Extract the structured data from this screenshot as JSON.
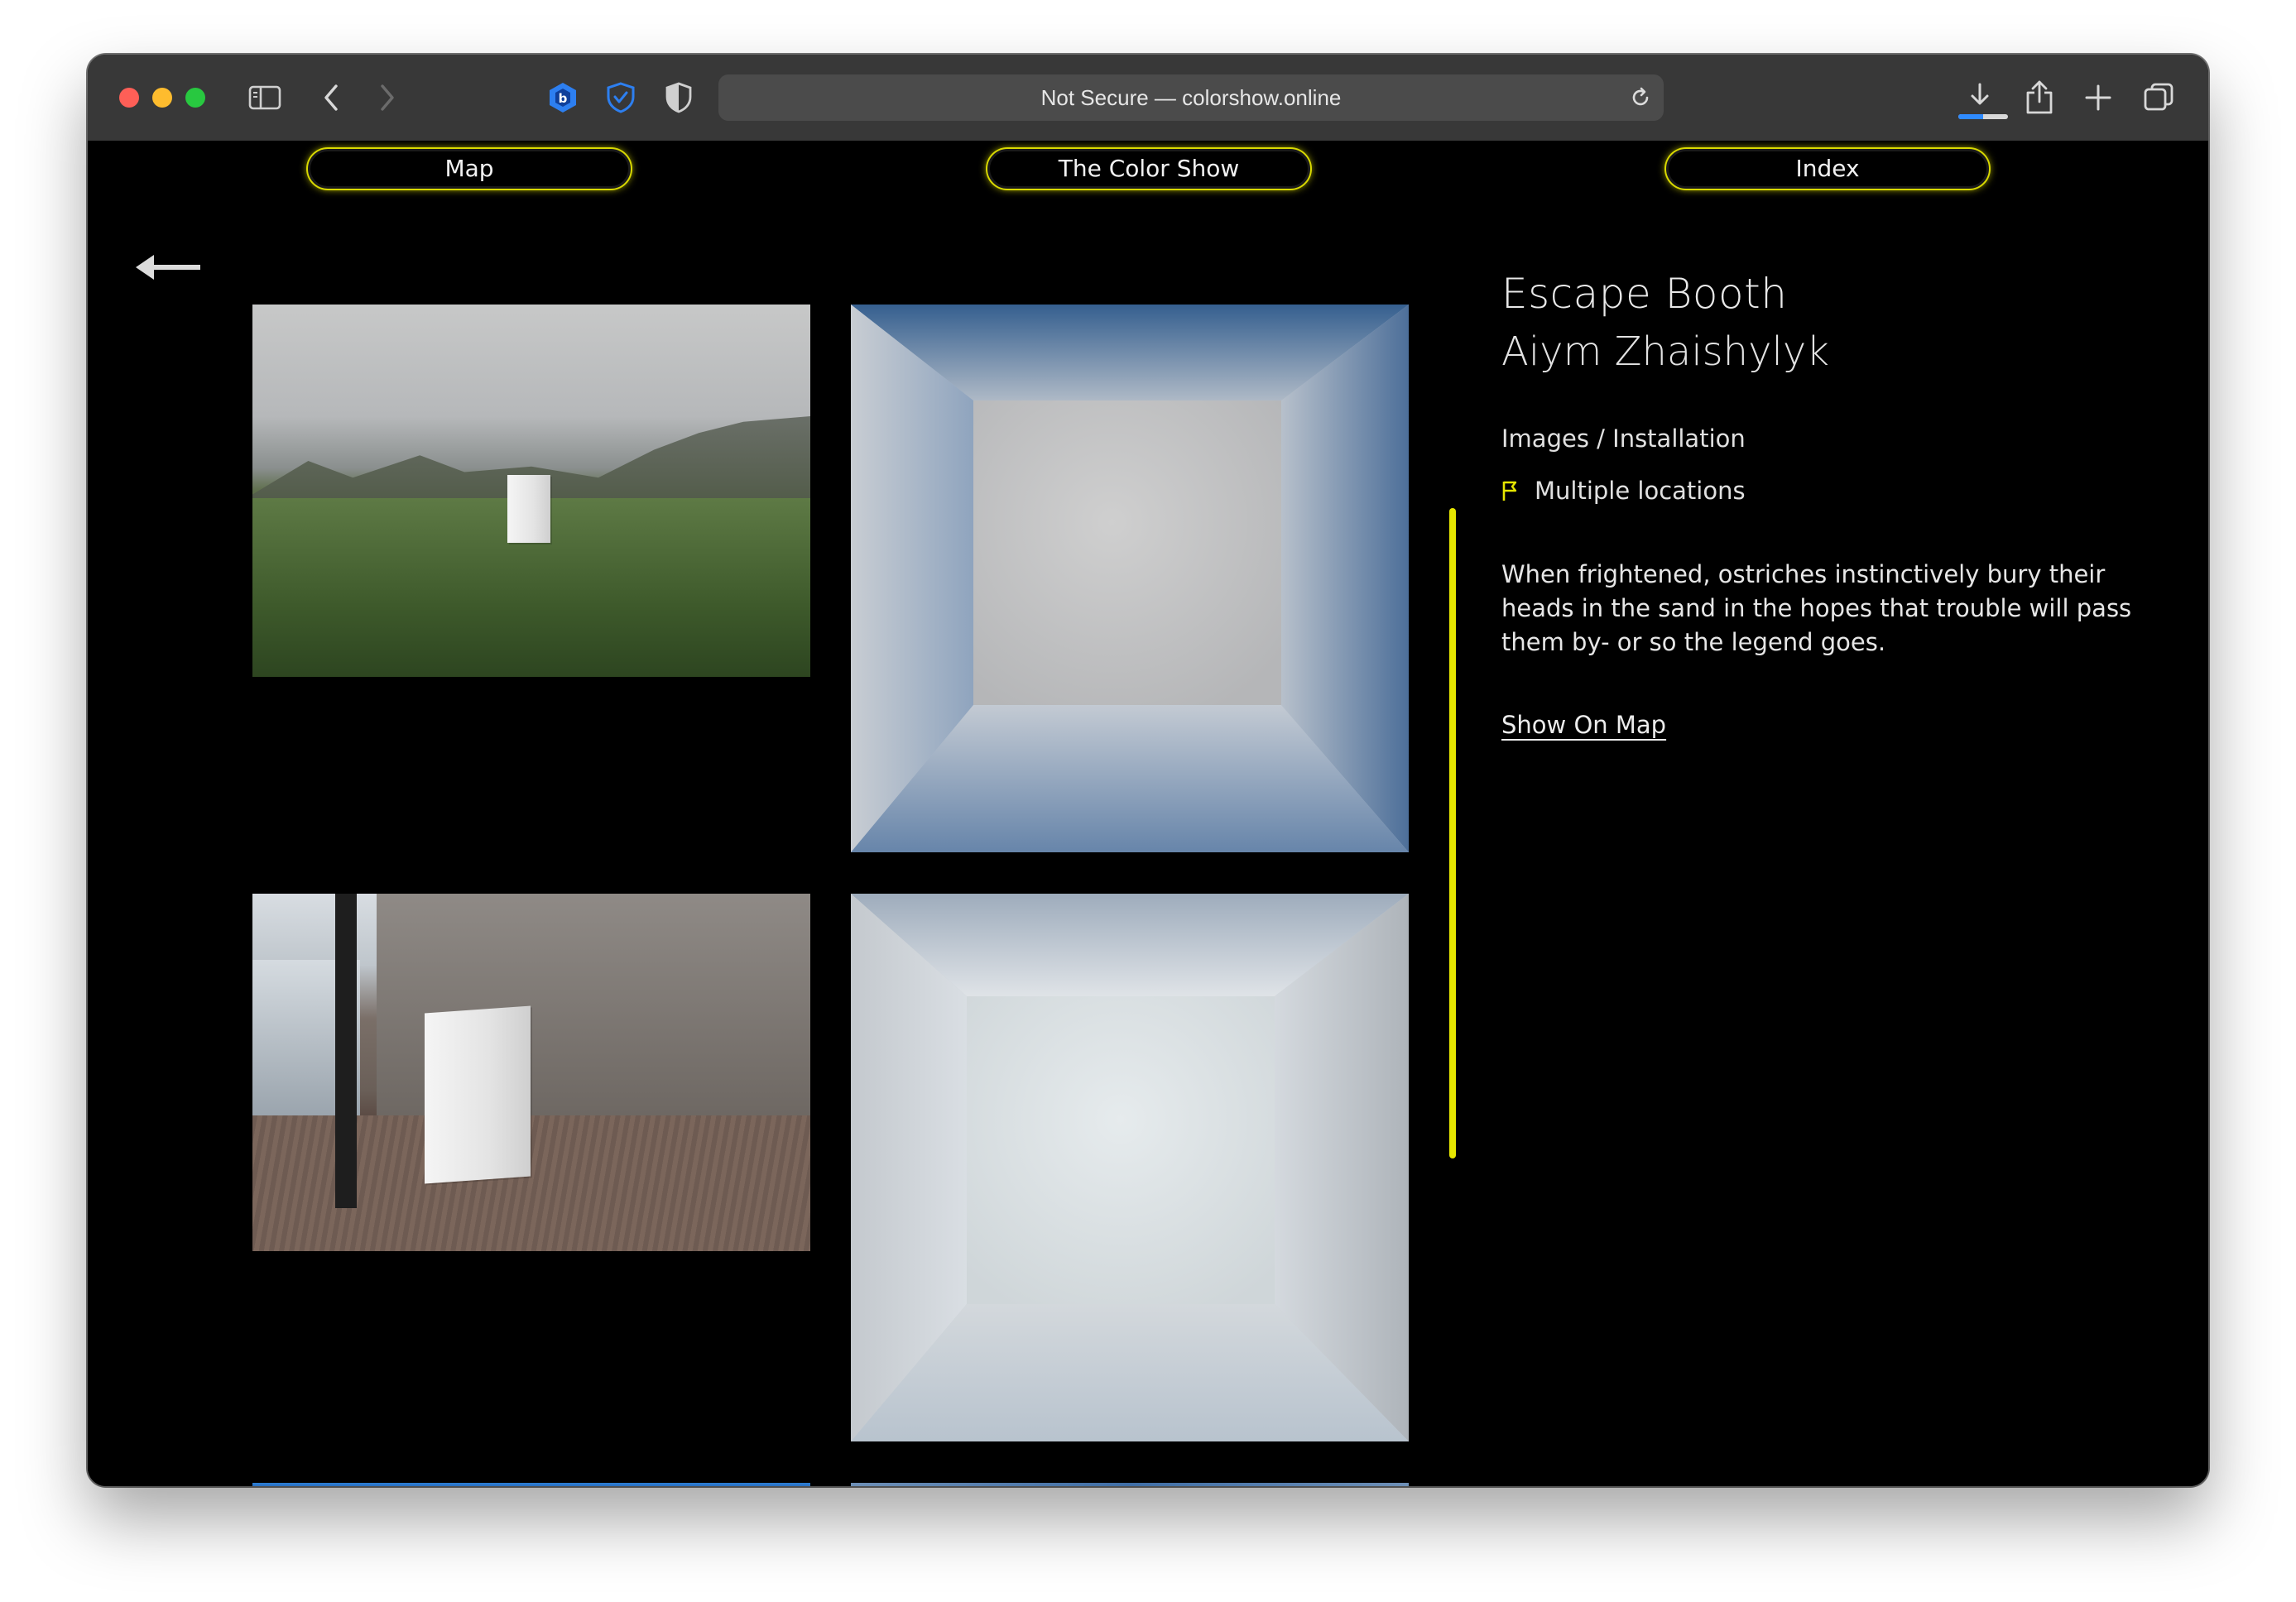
{
  "browser": {
    "url_text": "Not Secure — colorshow.online",
    "download_progress": 0.5
  },
  "nav": {
    "map": "Map",
    "show": "The Color Show",
    "index": "Index"
  },
  "artwork": {
    "title": "Escape Booth",
    "artist": "Aiym Zhaishylyk",
    "category": "Images / Installation",
    "location": "Multiple locations",
    "description": "When frightened, ostriches instinctively bury their heads in the sand in the hopes that trouble will pass them by- or so the legend goes.",
    "map_link": "Show On Map"
  },
  "colors": {
    "accent_yellow": "#e6e600",
    "background": "#000000"
  },
  "icons": [
    "sidebar-icon",
    "back-icon",
    "forward-icon",
    "extension-icon",
    "shield-check-icon",
    "privacy-shield-icon",
    "reload-icon",
    "download-icon",
    "share-icon",
    "plus-icon",
    "tabs-icon",
    "arrow-left-icon",
    "flag-icon"
  ]
}
